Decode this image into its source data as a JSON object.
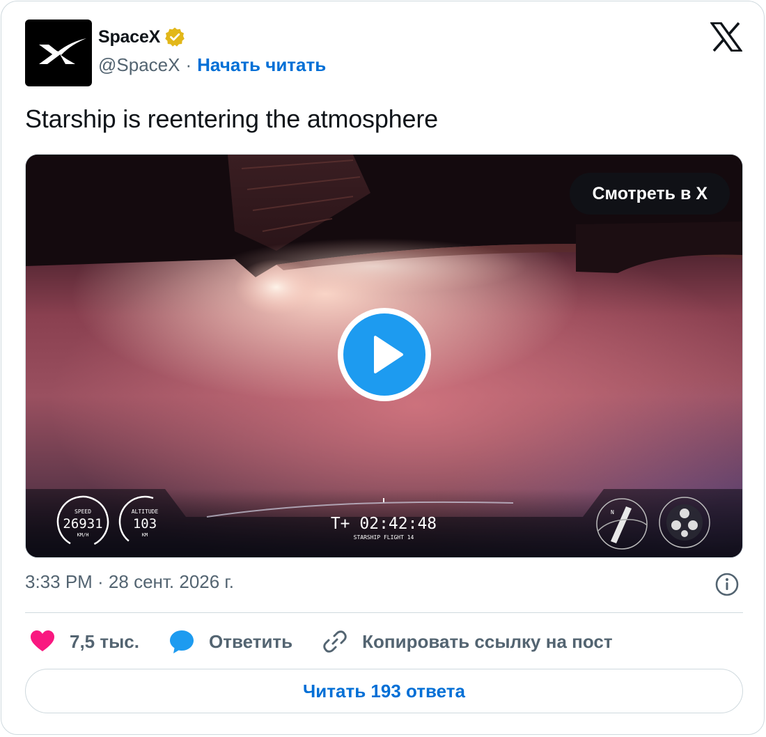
{
  "author": {
    "name": "SpaceX",
    "handle": "@SpaceX",
    "separator": "·",
    "follow_label": "Начать читать",
    "avatar_icon": "spacex-x-logo",
    "verified_icon": "gold-verified-badge",
    "verified_color": "#e2b719"
  },
  "platform_icon": "x-logo-icon",
  "tweet": {
    "text": "Starship is reentering the atmosphere"
  },
  "media": {
    "watch_label": "Смотреть в X",
    "play_icon": "play-icon",
    "play_color": "#1d9bf0",
    "hud": {
      "speed_label": "SPEED",
      "speed_value": "26931",
      "speed_unit": "KM/H",
      "altitude_label": "ALTITUDE",
      "altitude_value": "103",
      "altitude_unit": "KM",
      "timer": "T+ 02:42:48",
      "flight_label": "STARSHIP FLIGHT 14",
      "compass_letter": "N"
    }
  },
  "meta": {
    "timestamp": "3:33 PM · 28 сент. 2026 г.",
    "info_icon": "info-icon"
  },
  "actions": {
    "likes": "7,5 тыс.",
    "like_color": "#f91880",
    "reply_label": "Ответить",
    "reply_color": "#1d9bf0",
    "copy_label": "Копировать ссылку на пост"
  },
  "replies_button": "Читать 193 ответа",
  "accent_color": "#006fd6"
}
